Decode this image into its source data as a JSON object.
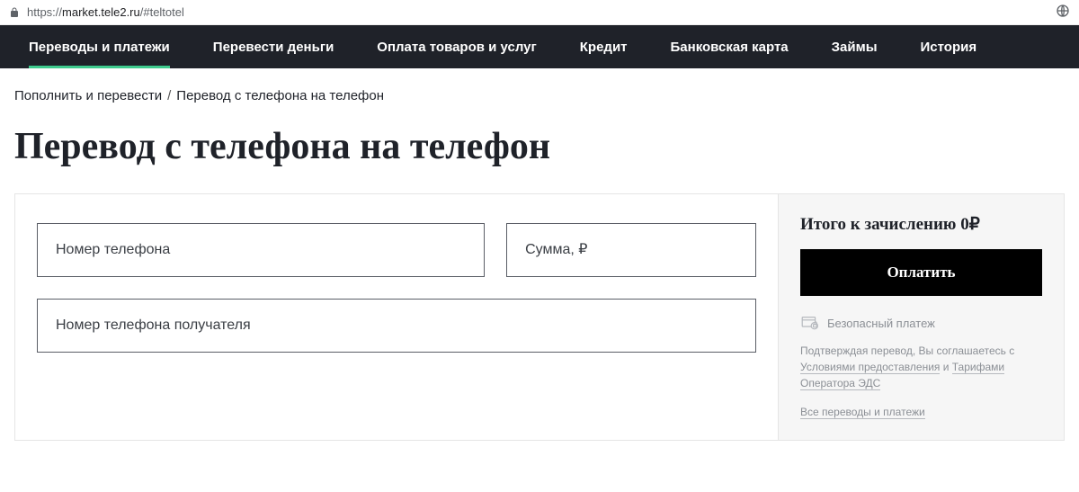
{
  "browser": {
    "url_protocol": "https://",
    "url_domain": "market.tele2.ru",
    "url_path": "/#teltotel"
  },
  "nav": {
    "items": [
      {
        "label": "Переводы и платежи",
        "active": true
      },
      {
        "label": "Перевести деньги",
        "active": false
      },
      {
        "label": "Оплата товаров и услуг",
        "active": false
      },
      {
        "label": "Кредит",
        "active": false
      },
      {
        "label": "Банковская карта",
        "active": false
      },
      {
        "label": "Займы",
        "active": false
      },
      {
        "label": "История",
        "active": false
      }
    ]
  },
  "breadcrumb": {
    "parent": "Пополнить и перевести",
    "sep": "/",
    "current": "Перевод с телефона на телефон"
  },
  "page": {
    "title": "Перевод с телефона на телефон"
  },
  "form": {
    "phone_placeholder": "Номер телефона",
    "amount_placeholder": "Сумма, ₽",
    "recipient_placeholder": "Номер телефона получателя"
  },
  "summary": {
    "total_label": "Итого к зачислению",
    "total_value": "0₽",
    "pay_button": "Оплатить",
    "secure_label": "Безопасный платеж",
    "legal_prefix": "Подтверждая перевод, Вы соглашаетесь с ",
    "legal_link1": "Условиями предоставления",
    "legal_mid": " и ",
    "legal_link2": "Тарифами Оператора ЭДС",
    "all_link": "Все переводы и платежи"
  }
}
